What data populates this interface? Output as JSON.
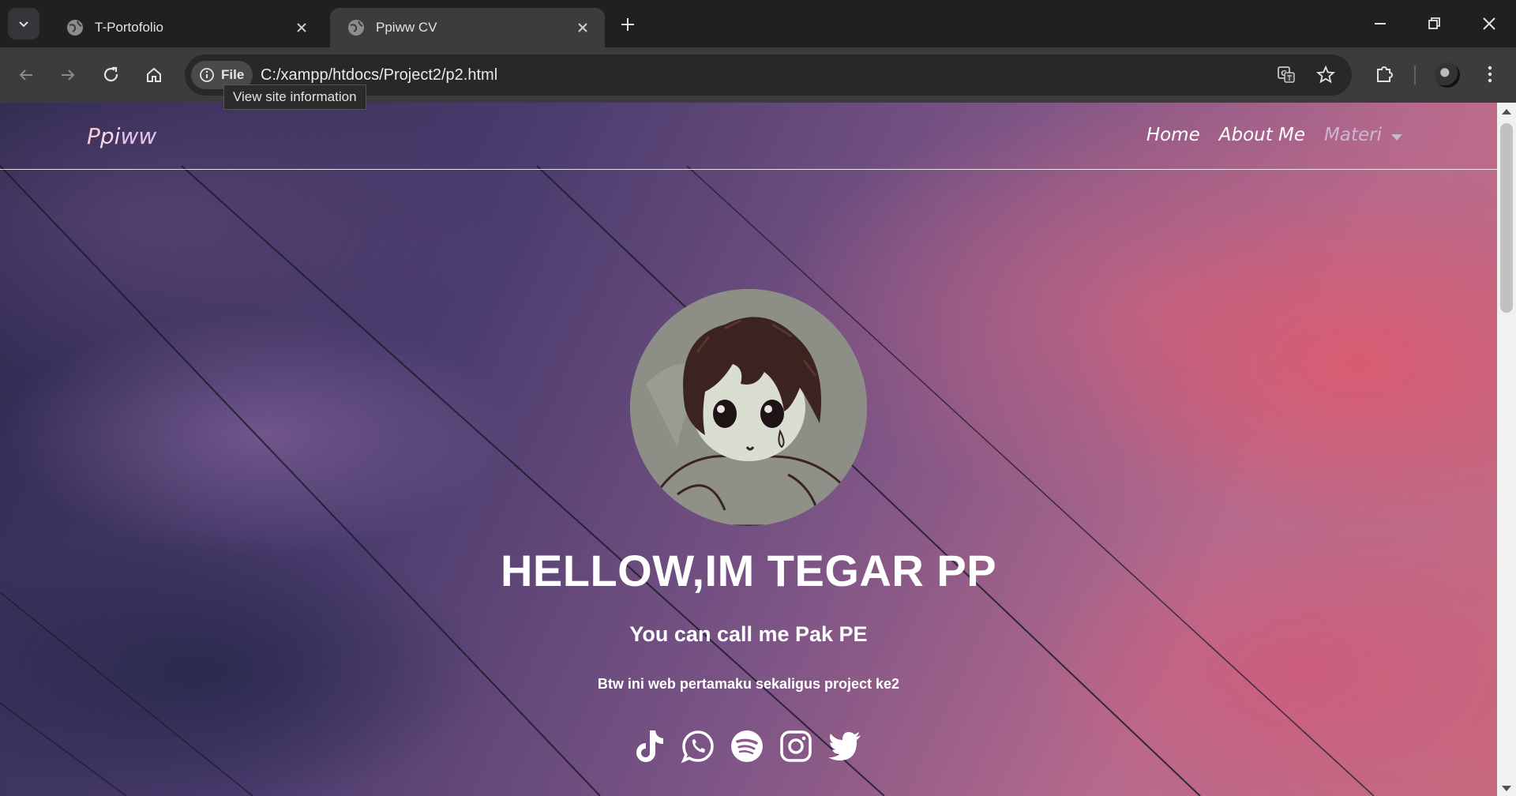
{
  "browser": {
    "tabs": [
      {
        "title": "T-Portofolio",
        "active": false
      },
      {
        "title": "Ppiww CV",
        "active": true
      }
    ],
    "address": {
      "chip_label": "File",
      "url": "C:/xampp/htdocs/Project2/p2.html"
    },
    "tooltip": "View site information"
  },
  "site": {
    "brand": {
      "part1": "P",
      "part2": "pi",
      "part3": "ww"
    },
    "nav": [
      {
        "label": "Home"
      },
      {
        "label": "About Me"
      },
      {
        "label": "Materi"
      }
    ],
    "hero": {
      "title": "HELLOW,IM TEGAR PP",
      "subtitle": "You can call me Pak PE",
      "caption": "Btw ini web pertamaku sekaligus project ke2"
    },
    "socials": [
      "tiktok-icon",
      "whatsapp-icon",
      "spotify-icon",
      "instagram-icon",
      "twitter-icon"
    ]
  }
}
